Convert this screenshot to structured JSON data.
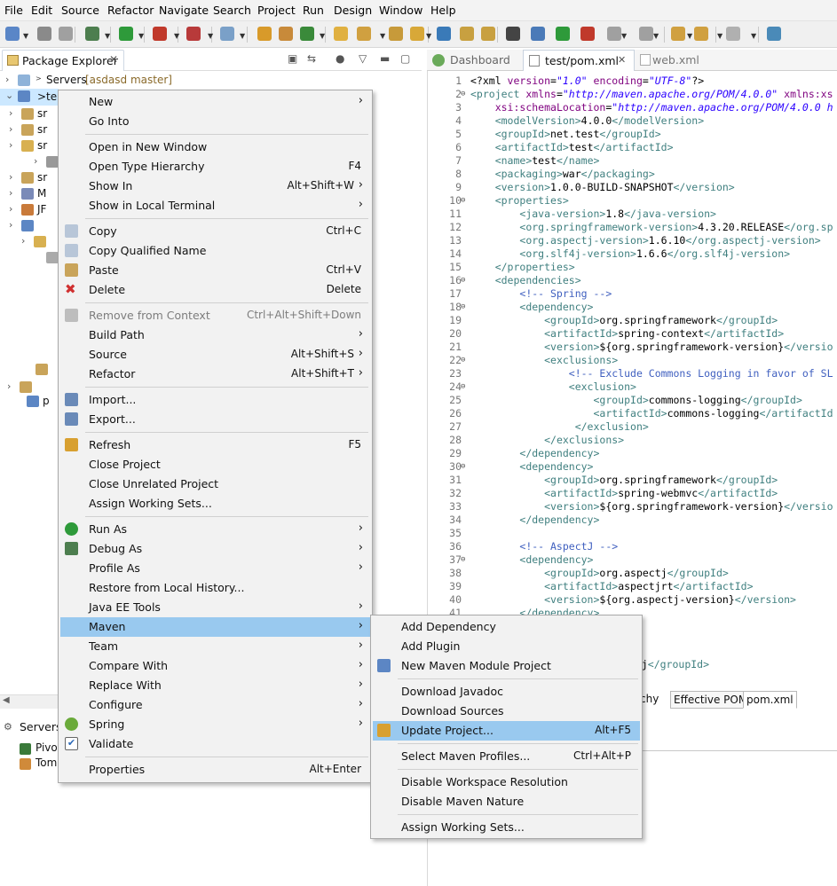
{
  "menubar": [
    "File",
    "Edit",
    "Source",
    "Refactor",
    "Navigate",
    "Search",
    "Project",
    "Run",
    "Design",
    "Window",
    "Help"
  ],
  "package_explorer": {
    "tab_label": "Package Explorer",
    "servers_label": "Servers",
    "servers_branch": "[asdasd master]",
    "selected_project_prefix": "te",
    "partial_rows": [
      "sr",
      "sr",
      "sr",
      "sr",
      "M",
      "JF",
      "p"
    ]
  },
  "servers_view": {
    "tab_label": "Servers",
    "items": [
      "Pivo",
      "Tom"
    ]
  },
  "editor": {
    "tabs": [
      "Dashboard",
      "test/pom.xml",
      "web.xml"
    ],
    "bottom_tabs": [
      "archy",
      "Effective POM",
      "pom.xml"
    ],
    "lines": [
      {
        "n": "1",
        "fold": false,
        "parts": [
          [
            "tx",
            "<?xml "
          ],
          [
            "an",
            "version"
          ],
          [
            "tx",
            "="
          ],
          [
            "av",
            "\"1.0\""
          ],
          [
            "tx",
            " "
          ],
          [
            "an",
            "encoding"
          ],
          [
            "tx",
            "="
          ],
          [
            "av",
            "\"UTF-8\""
          ],
          [
            "tx",
            "?>"
          ]
        ]
      },
      {
        "n": "2",
        "fold": true,
        "parts": [
          [
            "tg",
            "<project "
          ],
          [
            "an",
            "xmlns"
          ],
          [
            "tx",
            "="
          ],
          [
            "av",
            "\"http://maven.apache.org/POM/4.0.0\""
          ],
          [
            "tx",
            " "
          ],
          [
            "an",
            "xmlns:xs"
          ]
        ]
      },
      {
        "n": "3",
        "fold": false,
        "parts": [
          [
            "tx",
            "    "
          ],
          [
            "an",
            "xsi:schemaLocation"
          ],
          [
            "tx",
            "="
          ],
          [
            "av",
            "\"http://maven.apache.org/POM/4.0.0 h"
          ]
        ]
      },
      {
        "n": "4",
        "fold": false,
        "parts": [
          [
            "tx",
            "    "
          ],
          [
            "tg",
            "<modelVersion>"
          ],
          [
            "tx",
            "4.0.0"
          ],
          [
            "tg",
            "</modelVersion>"
          ]
        ]
      },
      {
        "n": "5",
        "fold": false,
        "parts": [
          [
            "tx",
            "    "
          ],
          [
            "tg",
            "<groupId>"
          ],
          [
            "tx",
            "net.test"
          ],
          [
            "tg",
            "</groupId>"
          ]
        ]
      },
      {
        "n": "6",
        "fold": false,
        "parts": [
          [
            "tx",
            "    "
          ],
          [
            "tg",
            "<artifactId>"
          ],
          [
            "tx",
            "test"
          ],
          [
            "tg",
            "</artifactId>"
          ]
        ]
      },
      {
        "n": "7",
        "fold": false,
        "parts": [
          [
            "tx",
            "    "
          ],
          [
            "tg",
            "<name>"
          ],
          [
            "tx",
            "test"
          ],
          [
            "tg",
            "</name>"
          ]
        ]
      },
      {
        "n": "8",
        "fold": false,
        "parts": [
          [
            "tx",
            "    "
          ],
          [
            "tg",
            "<packaging>"
          ],
          [
            "tx",
            "war"
          ],
          [
            "tg",
            "</packaging>"
          ]
        ]
      },
      {
        "n": "9",
        "fold": false,
        "parts": [
          [
            "tx",
            "    "
          ],
          [
            "tg",
            "<version>"
          ],
          [
            "tx",
            "1.0.0-BUILD-SNAPSHOT"
          ],
          [
            "tg",
            "</version>"
          ]
        ]
      },
      {
        "n": "10",
        "fold": true,
        "parts": [
          [
            "tx",
            "    "
          ],
          [
            "tg",
            "<properties>"
          ]
        ]
      },
      {
        "n": "11",
        "fold": false,
        "parts": [
          [
            "tx",
            "        "
          ],
          [
            "tg",
            "<java-version>"
          ],
          [
            "tx",
            "1.8"
          ],
          [
            "tg",
            "</java-version>"
          ]
        ]
      },
      {
        "n": "12",
        "fold": false,
        "parts": [
          [
            "tx",
            "        "
          ],
          [
            "tg",
            "<org.springframework-version>"
          ],
          [
            "tx",
            "4.3.20.RELEASE"
          ],
          [
            "tg",
            "</org.sp"
          ]
        ]
      },
      {
        "n": "13",
        "fold": false,
        "parts": [
          [
            "tx",
            "        "
          ],
          [
            "tg",
            "<org.aspectj-version>"
          ],
          [
            "tx",
            "1.6.10"
          ],
          [
            "tg",
            "</org.aspectj-version>"
          ]
        ]
      },
      {
        "n": "14",
        "fold": false,
        "parts": [
          [
            "tx",
            "        "
          ],
          [
            "tg",
            "<org.slf4j-version>"
          ],
          [
            "tx",
            "1.6.6"
          ],
          [
            "tg",
            "</org.slf4j-version>"
          ]
        ]
      },
      {
        "n": "15",
        "fold": false,
        "parts": [
          [
            "tx",
            "    "
          ],
          [
            "tg",
            "</properties>"
          ]
        ]
      },
      {
        "n": "16",
        "fold": true,
        "parts": [
          [
            "tx",
            "    "
          ],
          [
            "tg",
            "<dependencies>"
          ]
        ]
      },
      {
        "n": "17",
        "fold": false,
        "parts": [
          [
            "tx",
            "        "
          ],
          [
            "cm",
            "<!-- Spring -->"
          ]
        ]
      },
      {
        "n": "18",
        "fold": true,
        "parts": [
          [
            "tx",
            "        "
          ],
          [
            "tg",
            "<dependency>"
          ]
        ]
      },
      {
        "n": "19",
        "fold": false,
        "parts": [
          [
            "tx",
            "            "
          ],
          [
            "tg",
            "<groupId>"
          ],
          [
            "tx",
            "org.springframework"
          ],
          [
            "tg",
            "</groupId>"
          ]
        ]
      },
      {
        "n": "20",
        "fold": false,
        "parts": [
          [
            "tx",
            "            "
          ],
          [
            "tg",
            "<artifactId>"
          ],
          [
            "tx",
            "spring-context"
          ],
          [
            "tg",
            "</artifactId>"
          ]
        ]
      },
      {
        "n": "21",
        "fold": false,
        "parts": [
          [
            "tx",
            "            "
          ],
          [
            "tg",
            "<version>"
          ],
          [
            "tx",
            "${org.springframework-version}"
          ],
          [
            "tg",
            "</versio"
          ]
        ]
      },
      {
        "n": "22",
        "fold": true,
        "parts": [
          [
            "tx",
            "            "
          ],
          [
            "tg",
            "<exclusions>"
          ]
        ]
      },
      {
        "n": "23",
        "fold": false,
        "parts": [
          [
            "tx",
            "                "
          ],
          [
            "cm",
            "<!-- Exclude Commons Logging in favor of SL"
          ]
        ]
      },
      {
        "n": "24",
        "fold": true,
        "parts": [
          [
            "tx",
            "                "
          ],
          [
            "tg",
            "<exclusion>"
          ]
        ]
      },
      {
        "n": "25",
        "fold": false,
        "parts": [
          [
            "tx",
            "                    "
          ],
          [
            "tg",
            "<groupId>"
          ],
          [
            "tx",
            "commons-logging"
          ],
          [
            "tg",
            "</groupId>"
          ]
        ]
      },
      {
        "n": "26",
        "fold": false,
        "parts": [
          [
            "tx",
            "                    "
          ],
          [
            "tg",
            "<artifactId>"
          ],
          [
            "tx",
            "commons-logging"
          ],
          [
            "tg",
            "</artifactId"
          ]
        ]
      },
      {
        "n": "27",
        "fold": false,
        "parts": [
          [
            "tx",
            "                 "
          ],
          [
            "tg",
            "</exclusion>"
          ]
        ]
      },
      {
        "n": "28",
        "fold": false,
        "parts": [
          [
            "tx",
            "            "
          ],
          [
            "tg",
            "</exclusions>"
          ]
        ]
      },
      {
        "n": "29",
        "fold": false,
        "parts": [
          [
            "tx",
            "        "
          ],
          [
            "tg",
            "</dependency>"
          ]
        ]
      },
      {
        "n": "30",
        "fold": true,
        "parts": [
          [
            "tx",
            "        "
          ],
          [
            "tg",
            "<dependency>"
          ]
        ]
      },
      {
        "n": "31",
        "fold": false,
        "parts": [
          [
            "tx",
            "            "
          ],
          [
            "tg",
            "<groupId>"
          ],
          [
            "tx",
            "org.springframework"
          ],
          [
            "tg",
            "</groupId>"
          ]
        ]
      },
      {
        "n": "32",
        "fold": false,
        "parts": [
          [
            "tx",
            "            "
          ],
          [
            "tg",
            "<artifactId>"
          ],
          [
            "tx",
            "spring-webmvc"
          ],
          [
            "tg",
            "</artifactId>"
          ]
        ]
      },
      {
        "n": "33",
        "fold": false,
        "parts": [
          [
            "tx",
            "            "
          ],
          [
            "tg",
            "<version>"
          ],
          [
            "tx",
            "${org.springframework-version}"
          ],
          [
            "tg",
            "</versio"
          ]
        ]
      },
      {
        "n": "34",
        "fold": false,
        "parts": [
          [
            "tx",
            "        "
          ],
          [
            "tg",
            "</dependency>"
          ]
        ]
      },
      {
        "n": "35",
        "fold": false,
        "parts": []
      },
      {
        "n": "36",
        "fold": false,
        "parts": [
          [
            "tx",
            "        "
          ],
          [
            "cm",
            "<!-- AspectJ -->"
          ]
        ]
      },
      {
        "n": "37",
        "fold": true,
        "parts": [
          [
            "tx",
            "        "
          ],
          [
            "tg",
            "<dependency>"
          ]
        ]
      },
      {
        "n": "38",
        "fold": false,
        "parts": [
          [
            "tx",
            "            "
          ],
          [
            "tg",
            "<groupId>"
          ],
          [
            "tx",
            "org.aspectj"
          ],
          [
            "tg",
            "</groupId>"
          ]
        ]
      },
      {
        "n": "39",
        "fold": false,
        "parts": [
          [
            "tx",
            "            "
          ],
          [
            "tg",
            "<artifactId>"
          ],
          [
            "tx",
            "aspectjrt"
          ],
          [
            "tg",
            "</artifactId>"
          ]
        ]
      },
      {
        "n": "40",
        "fold": false,
        "parts": [
          [
            "tx",
            "            "
          ],
          [
            "tg",
            "<version>"
          ],
          [
            "tx",
            "${org.aspectj-version}"
          ],
          [
            "tg",
            "</version>"
          ]
        ]
      },
      {
        "n": "41",
        "fold": false,
        "parts": [
          [
            "tx",
            "        "
          ],
          [
            "tg",
            "</dependency>"
          ]
        ]
      }
    ],
    "peek_line": {
      "text": "f4j",
      "close": "</groupId>"
    }
  },
  "context_menu": [
    {
      "label": "New",
      "shortcut": "",
      "submenu": true,
      "icon": "",
      "disabled": false
    },
    {
      "label": "Go Into",
      "shortcut": "",
      "submenu": false,
      "icon": "",
      "disabled": false
    },
    {
      "sep": true
    },
    {
      "label": "Open in New Window",
      "shortcut": "",
      "submenu": false,
      "icon": "",
      "disabled": false
    },
    {
      "label": "Open Type Hierarchy",
      "shortcut": "F4",
      "submenu": false,
      "icon": "",
      "disabled": false
    },
    {
      "label": "Show In",
      "shortcut": "Alt+Shift+W",
      "submenu": true,
      "icon": "",
      "disabled": false
    },
    {
      "label": "Show in Local Terminal",
      "shortcut": "",
      "submenu": true,
      "icon": "",
      "disabled": false
    },
    {
      "sep": true
    },
    {
      "label": "Copy",
      "shortcut": "Ctrl+C",
      "submenu": false,
      "icon": "copy-icon",
      "disabled": false
    },
    {
      "label": "Copy Qualified Name",
      "shortcut": "",
      "submenu": false,
      "icon": "copy-qualified-icon",
      "disabled": false
    },
    {
      "label": "Paste",
      "shortcut": "Ctrl+V",
      "submenu": false,
      "icon": "paste-icon",
      "disabled": false
    },
    {
      "label": "Delete",
      "shortcut": "Delete",
      "submenu": false,
      "icon": "delete-icon",
      "disabled": false
    },
    {
      "sep": true
    },
    {
      "label": "Remove from Context",
      "shortcut": "Ctrl+Alt+Shift+Down",
      "submenu": false,
      "icon": "remove-context-icon",
      "disabled": true
    },
    {
      "label": "Build Path",
      "shortcut": "",
      "submenu": true,
      "icon": "",
      "disabled": false
    },
    {
      "label": "Source",
      "shortcut": "Alt+Shift+S",
      "submenu": true,
      "icon": "",
      "disabled": false
    },
    {
      "label": "Refactor",
      "shortcut": "Alt+Shift+T",
      "submenu": true,
      "icon": "",
      "disabled": false
    },
    {
      "sep": true
    },
    {
      "label": "Import...",
      "shortcut": "",
      "submenu": false,
      "icon": "import-icon",
      "disabled": false
    },
    {
      "label": "Export...",
      "shortcut": "",
      "submenu": false,
      "icon": "export-icon",
      "disabled": false
    },
    {
      "sep": true
    },
    {
      "label": "Refresh",
      "shortcut": "F5",
      "submenu": false,
      "icon": "refresh-icon",
      "disabled": false
    },
    {
      "label": "Close Project",
      "shortcut": "",
      "submenu": false,
      "icon": "",
      "disabled": false
    },
    {
      "label": "Close Unrelated Project",
      "shortcut": "",
      "submenu": false,
      "icon": "",
      "disabled": false
    },
    {
      "label": "Assign Working Sets...",
      "shortcut": "",
      "submenu": false,
      "icon": "",
      "disabled": false
    },
    {
      "sep": true
    },
    {
      "label": "Run As",
      "shortcut": "",
      "submenu": true,
      "icon": "run-icon",
      "disabled": false
    },
    {
      "label": "Debug As",
      "shortcut": "",
      "submenu": true,
      "icon": "debug-icon",
      "disabled": false
    },
    {
      "label": "Profile As",
      "shortcut": "",
      "submenu": true,
      "icon": "",
      "disabled": false
    },
    {
      "label": "Restore from Local History...",
      "shortcut": "",
      "submenu": false,
      "icon": "",
      "disabled": false
    },
    {
      "label": "Java EE Tools",
      "shortcut": "",
      "submenu": true,
      "icon": "",
      "disabled": false
    },
    {
      "label": "Maven",
      "shortcut": "",
      "submenu": true,
      "icon": "",
      "disabled": false,
      "selected": true
    },
    {
      "label": "Team",
      "shortcut": "",
      "submenu": true,
      "icon": "",
      "disabled": false
    },
    {
      "label": "Compare With",
      "shortcut": "",
      "submenu": true,
      "icon": "",
      "disabled": false
    },
    {
      "label": "Replace With",
      "shortcut": "",
      "submenu": true,
      "icon": "",
      "disabled": false
    },
    {
      "label": "Configure",
      "shortcut": "",
      "submenu": true,
      "icon": "",
      "disabled": false
    },
    {
      "label": "Spring",
      "shortcut": "",
      "submenu": true,
      "icon": "spring-icon",
      "disabled": false
    },
    {
      "label": "Validate",
      "shortcut": "",
      "submenu": false,
      "icon": "validate-icon",
      "disabled": false
    },
    {
      "sep": true
    },
    {
      "label": "Properties",
      "shortcut": "Alt+Enter",
      "submenu": false,
      "icon": "",
      "disabled": false
    }
  ],
  "maven_submenu": [
    {
      "label": "Add Dependency",
      "shortcut": "",
      "icon": ""
    },
    {
      "label": "Add Plugin",
      "shortcut": "",
      "icon": ""
    },
    {
      "label": "New Maven Module Project",
      "shortcut": "",
      "icon": "maven-module-icon"
    },
    {
      "sep": true
    },
    {
      "label": "Download Javadoc",
      "shortcut": "",
      "icon": ""
    },
    {
      "label": "Download Sources",
      "shortcut": "",
      "icon": ""
    },
    {
      "label": "Update Project...",
      "shortcut": "Alt+F5",
      "icon": "update-project-icon",
      "selected": true
    },
    {
      "sep": true
    },
    {
      "label": "Select Maven Profiles...",
      "shortcut": "Ctrl+Alt+P",
      "icon": ""
    },
    {
      "sep": true
    },
    {
      "label": "Disable Workspace Resolution",
      "shortcut": "",
      "icon": ""
    },
    {
      "label": "Disable Maven Nature",
      "shortcut": "",
      "icon": ""
    },
    {
      "sep": true
    },
    {
      "label": "Assign Working Sets...",
      "shortcut": "",
      "icon": ""
    }
  ],
  "colors": {
    "selection": "#99c9ef",
    "menu_bg": "#f2f2f2",
    "xml_tag": "#3f7f7f",
    "xml_attr": "#7f007f",
    "xml_value": "#2a00ff",
    "xml_comment": "#3f5fbf"
  }
}
